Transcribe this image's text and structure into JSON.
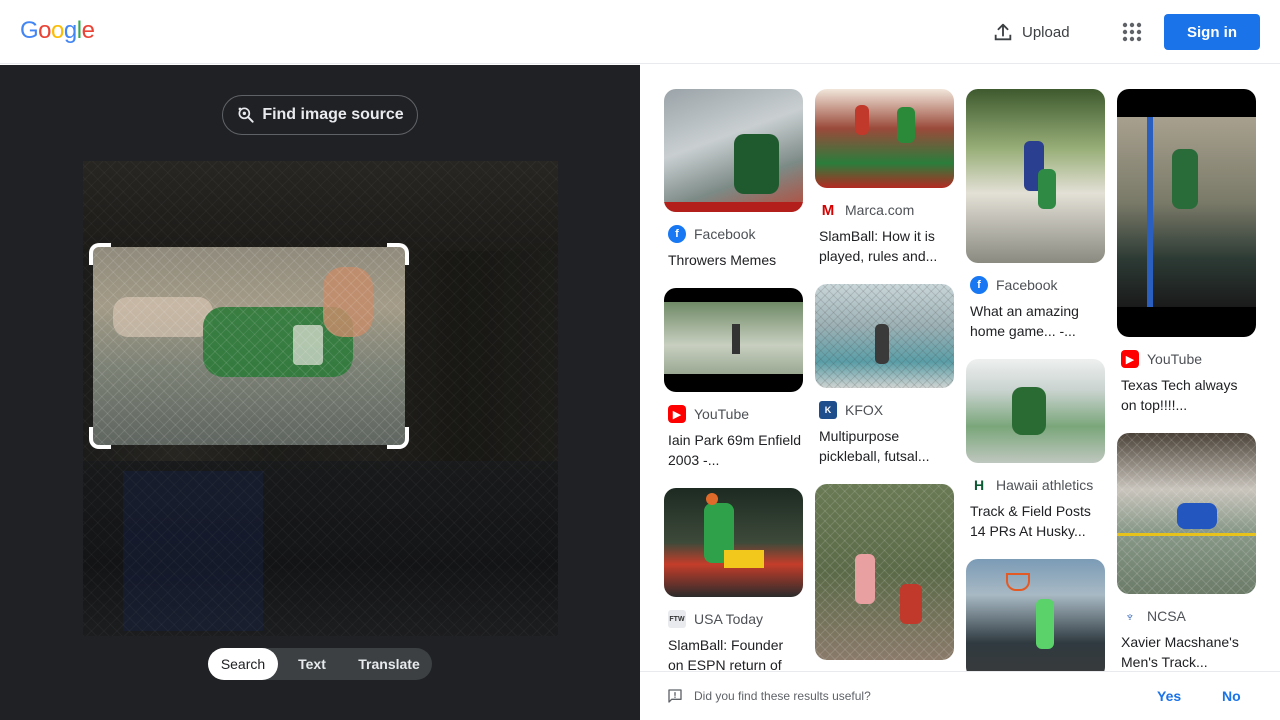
{
  "header": {
    "logo_letters": [
      {
        "ch": "G",
        "color": "#4285F4"
      },
      {
        "ch": "o",
        "color": "#EA4335"
      },
      {
        "ch": "o",
        "color": "#FBBC05"
      },
      {
        "ch": "g",
        "color": "#4285F4"
      },
      {
        "ch": "l",
        "color": "#34A853"
      },
      {
        "ch": "e",
        "color": "#EA4335"
      }
    ],
    "upload_label": "Upload",
    "apps_icon": "apps-grid-icon",
    "signin_label": "Sign in"
  },
  "left": {
    "find_source_label": "Find image source",
    "modes": [
      {
        "label": "Search",
        "active": true
      },
      {
        "label": "Text",
        "active": false
      },
      {
        "label": "Translate",
        "active": false
      }
    ]
  },
  "results": {
    "columns": [
      [
        {
          "source": "Facebook",
          "title": "Throwers Memes",
          "favicon": "facebook"
        },
        {
          "source": "YouTube",
          "title": "Iain Park 69m Enfield 2003 -...",
          "favicon": "youtube"
        },
        {
          "source": "USA Today",
          "title": "SlamBall: Founder on ESPN return of",
          "favicon": "ftw"
        }
      ],
      [
        {
          "source": "Marca.com",
          "title": "SlamBall: How it is played, rules and...",
          "favicon": "marca"
        },
        {
          "source": "KFOX",
          "title": "Multipurpose pickleball, futsal...",
          "favicon": "kfox"
        },
        {
          "source": "",
          "title": "",
          "favicon": ""
        }
      ],
      [
        {
          "source": "Facebook",
          "title": "What an amazing home game... -...",
          "favicon": "facebook"
        },
        {
          "source": "Hawaii athletics",
          "title": "Track & Field Posts 14 PRs At Husky...",
          "favicon": "hawaii"
        },
        {
          "source": "",
          "title": "",
          "favicon": ""
        }
      ],
      [
        {
          "source": "YouTube",
          "title": "Texas Tech always on top!!!!...",
          "favicon": "youtube"
        },
        {
          "source": "NCSA",
          "title": "Xavier Macshane's Men's Track...",
          "favicon": "ncsa"
        }
      ]
    ]
  },
  "feedback": {
    "question": "Did you find these results useful?",
    "yes": "Yes",
    "no": "No"
  },
  "colors": {
    "accent": "#1a73e8",
    "left_bg": "#202124",
    "facebook": "#1877F2",
    "youtube": "#FF0000",
    "marca": "#d60000"
  }
}
